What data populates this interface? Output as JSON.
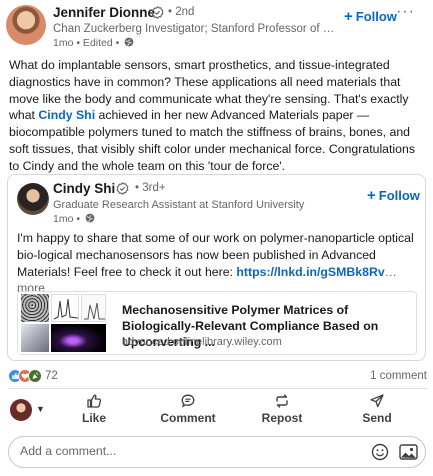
{
  "post": {
    "author": {
      "name": "Jennifer Dionne",
      "degree": "• 2nd",
      "headline": "Chan Zuckerberg Investigator; Stanford Professor of Materials Science",
      "time": "1mo • Edited •"
    },
    "follow_label": "Follow",
    "more_label": "···",
    "text_part1": "What do implantable sensors, smart prosthetics, and tissue-integrated diagnostics have in common? These applications all need materials that move like the body and communicate what they're sensing. That's exactly what ",
    "mention": "Cindy Shi",
    "text_part2": " achieved in her new Advanced Materials paper — biocompatible polymers tuned to match the stiffness of brains, bones, and soft tissues, that visibly shift color under mechanical force. Congratulations to Cindy and the whole team on this 'tour de force'."
  },
  "shared": {
    "author": {
      "name": "Cindy Shi",
      "degree": "• 3rd+",
      "headline": "Graduate Research Assistant at Stanford University",
      "time": "1mo •"
    },
    "follow_label": "Follow",
    "text": "I'm happy to share that some of our work on polymer-nanoparticle optical bio-logical mechanosensors has now been published in Advanced Materials! Feel free to check it out here: ",
    "link": "https://lnkd.in/gSMBk8Rv",
    "more": "… more",
    "preview": {
      "title": "Mechanosensitive Polymer Matrices of Biologically-Relevant Compliance Based on Upconverting ...",
      "domain": "advanced.onlinelibrary.wiley.com"
    }
  },
  "social": {
    "reaction_count": "72",
    "comment_count": "1 comment",
    "reaction_icons": [
      "like-icon",
      "love-icon",
      "celebrate-icon"
    ]
  },
  "actions": {
    "like": "Like",
    "comment": "Comment",
    "repost": "Repost",
    "send": "Send"
  },
  "comment_box": {
    "placeholder": "Add a comment..."
  },
  "colors": {
    "accent": "#0a66c2",
    "text": "#191919",
    "muted": "#666666"
  }
}
